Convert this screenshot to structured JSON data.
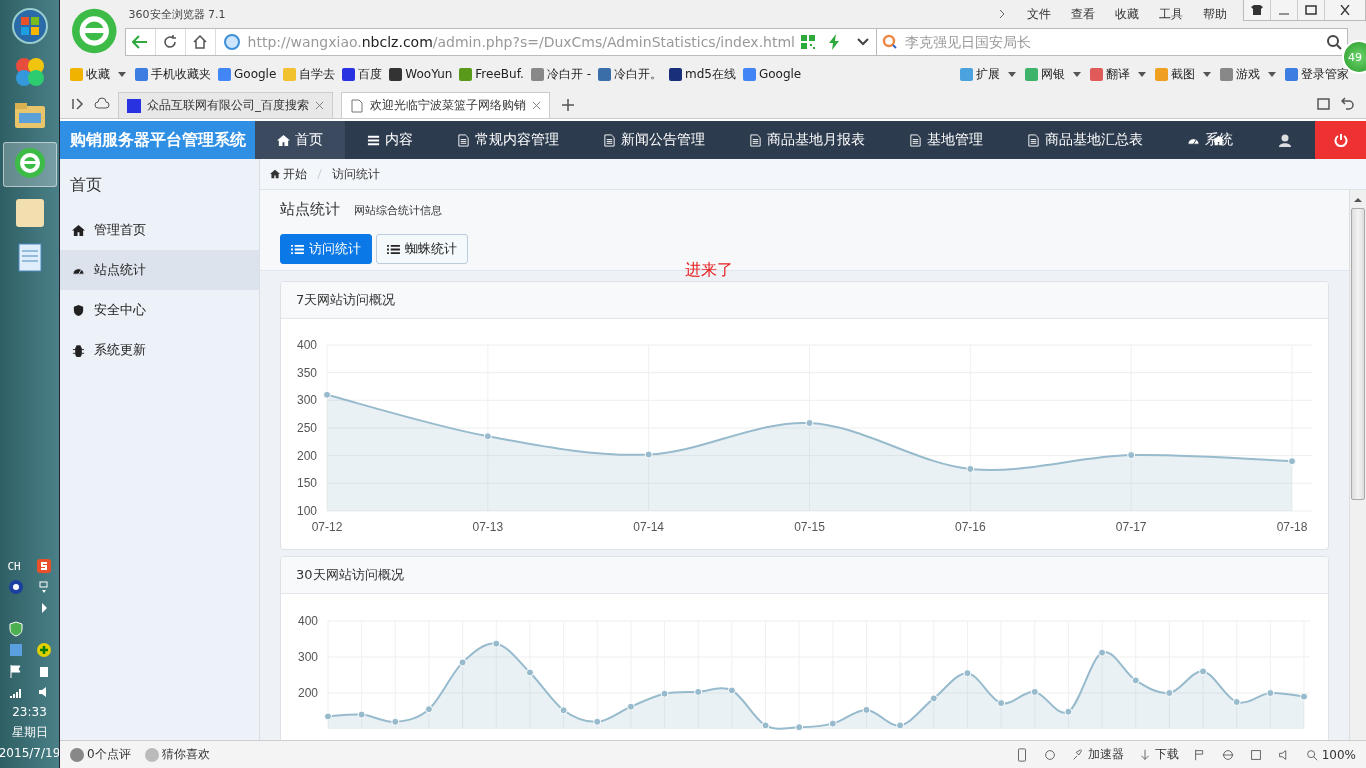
{
  "taskbar": {
    "language": "CH",
    "time": "23:33",
    "weekday": "星期日",
    "date": "2015/7/19"
  },
  "browser": {
    "title": "360安全浏览器 7.1",
    "menu": [
      "文件",
      "查看",
      "收藏",
      "工具",
      "帮助"
    ],
    "url_prefix": "http://wangxiao.",
    "url_domain": "nbclz.com",
    "url_path": "/admin.php?s=/DuxCms/AdminStatistics/index.html",
    "search": {
      "placeholder": "李克强见日国安局长"
    },
    "badge": "49",
    "bookmarks": [
      "收藏",
      "手机收藏夹",
      "Google",
      "自学去",
      "百度",
      "WooYun",
      "FreeBuf.",
      "冷白开 -",
      "冷白开。",
      "md5在线",
      "Google"
    ],
    "tools": [
      "扩展",
      "网银",
      "翻译",
      "截图",
      "游戏",
      "登录管家"
    ],
    "tabs": [
      {
        "title": "众品互联网有限公司_百度搜索",
        "selected": false
      },
      {
        "title": "欢迎光临宁波菜篮子网络购销",
        "selected": true
      }
    ]
  },
  "app": {
    "brand": "购销服务器平台管理系统",
    "nav": [
      {
        "label": "首页",
        "selected": true
      },
      {
        "label": "内容",
        "selected": false
      },
      {
        "label": "常规内容管理",
        "selected": false
      },
      {
        "label": "新闻公告管理",
        "selected": false
      },
      {
        "label": "商品基地月报表",
        "selected": false
      },
      {
        "label": "基地管理",
        "selected": false
      },
      {
        "label": "商品基地汇总表",
        "selected": false
      },
      {
        "label": "系统",
        "selected": false
      }
    ],
    "sidebar": {
      "title": "首页",
      "items": [
        {
          "label": "管理首页",
          "selected": false
        },
        {
          "label": "站点统计",
          "selected": true
        },
        {
          "label": "安全中心",
          "selected": false
        },
        {
          "label": "系统更新",
          "selected": false
        }
      ]
    },
    "breadcrumb": [
      "开始",
      "访问统计"
    ],
    "page_title": "站点统计",
    "page_subtitle": "网站综合统计信息",
    "buttons": [
      {
        "label": "访问统计",
        "selected": true
      },
      {
        "label": "蜘蛛统计",
        "selected": false
      }
    ],
    "note": "进来了",
    "cards": [
      {
        "title": "7天网站访问概况",
        "chart_data": {
          "type": "area",
          "categories": [
            "07-12",
            "07-13",
            "07-14",
            "07-15",
            "07-16",
            "07-17",
            "07-18"
          ],
          "series": [
            {
              "color": "#97bbcd",
              "values": [
                310,
                235,
                202,
                259,
                176,
                201,
                190
              ]
            }
          ],
          "ylim": [
            100,
            400
          ],
          "yticks": [
            100,
            150,
            200,
            250,
            300,
            350,
            400
          ],
          "grid": true
        }
      },
      {
        "title": "30天网站访问概况",
        "chart_data": {
          "type": "area",
          "series": [
            {
              "color": "#97bbcd",
              "values": [
                135,
                140,
                120,
                155,
                285,
                337,
                257,
                152,
                120,
                162,
                198,
                203,
                207,
                110,
                105,
                115,
                153,
                110,
                185,
                255,
                172,
                203,
                148,
                312,
                235,
                200,
                260,
                175,
                200,
                190
              ]
            }
          ],
          "ylim": [
            100,
            400
          ],
          "yticks": [
            200,
            300,
            400
          ],
          "grid": true
        }
      }
    ]
  },
  "status": {
    "comments": "0个点评",
    "guess": "猜你喜欢",
    "tools": [
      "加速器",
      "下载"
    ],
    "zoom": "100%"
  }
}
